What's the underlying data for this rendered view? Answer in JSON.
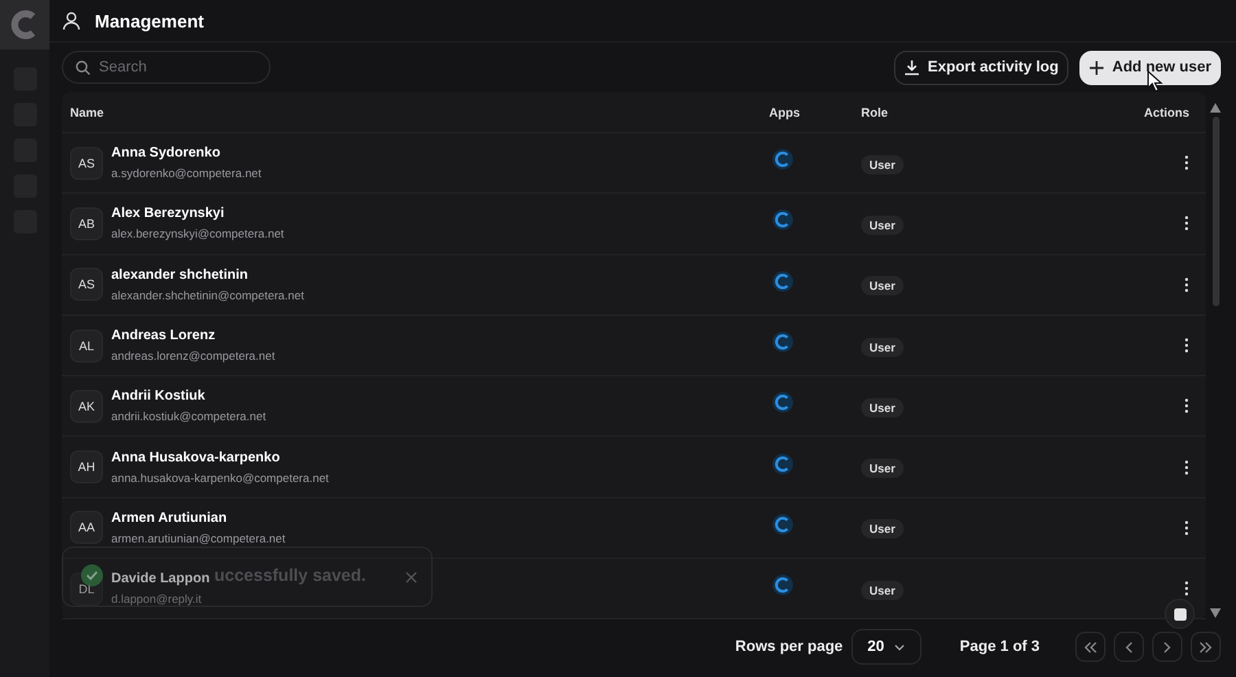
{
  "header": {
    "title": "Management"
  },
  "search": {
    "placeholder": "Search"
  },
  "buttons": [
    {
      "label": "Export activity log",
      "kind": "export"
    },
    {
      "label": "Add new user",
      "kind": "add"
    }
  ],
  "table": {
    "columns": [
      "Name",
      "Apps",
      "Role",
      "Actions"
    ],
    "rows": [
      {
        "initials": "AS",
        "name": "Anna Sydorenko",
        "email": "a.sydorenko@competera.net",
        "role": "User"
      },
      {
        "initials": "AB",
        "name": "Alex Berezynskyi",
        "email": "alex.berezynskyi@competera.net",
        "role": "User"
      },
      {
        "initials": "AS",
        "name": "alexander shchetinin",
        "email": "alexander.shchetinin@competera.net",
        "role": "User"
      },
      {
        "initials": "AL",
        "name": "Andreas Lorenz",
        "email": "andreas.lorenz@competera.net",
        "role": "User"
      },
      {
        "initials": "AK",
        "name": "Andrii Kostiuk",
        "email": "andrii.kostiuk@competera.net",
        "role": "User"
      },
      {
        "initials": "AH",
        "name": "Anna Husakova-karpenko",
        "email": "anna.husakova-karpenko@competera.net",
        "role": "User"
      },
      {
        "initials": "AA",
        "name": "Armen Arutiunian",
        "email": "armen.arutiunian@competera.net",
        "role": "User"
      },
      {
        "initials": "DL",
        "name": "Davide Lappon",
        "email": "d.lappon@reply.it",
        "role": "User"
      }
    ]
  },
  "toast": {
    "message": "uccessfully saved."
  },
  "pagination": {
    "rows_label": "Rows per page",
    "rows_value": "20",
    "page_label": "Page 1 of 3"
  }
}
